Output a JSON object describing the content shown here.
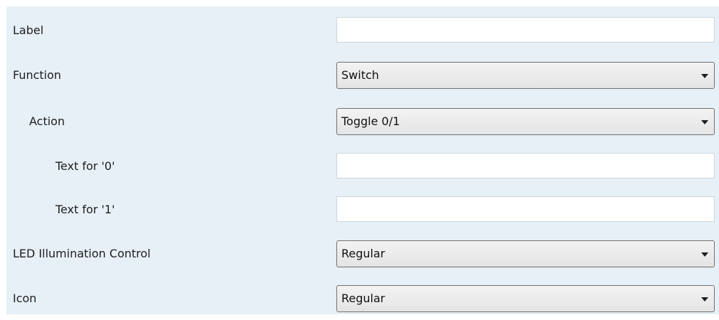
{
  "fields": {
    "label": {
      "label": "Label",
      "value": ""
    },
    "function": {
      "label": "Function",
      "value": "Switch"
    },
    "action": {
      "label": "Action",
      "value": "Toggle 0/1"
    },
    "text0": {
      "label": "Text for '0'",
      "value": ""
    },
    "text1": {
      "label": "Text for '1'",
      "value": ""
    },
    "led": {
      "label": "LED Illumination Control",
      "value": "Regular"
    },
    "icon": {
      "label": "Icon",
      "value": "Regular"
    }
  },
  "colors": {
    "panel_background": "#e8f0f7",
    "field_border": "#cdd5de",
    "dropdown_border": "#707070"
  }
}
